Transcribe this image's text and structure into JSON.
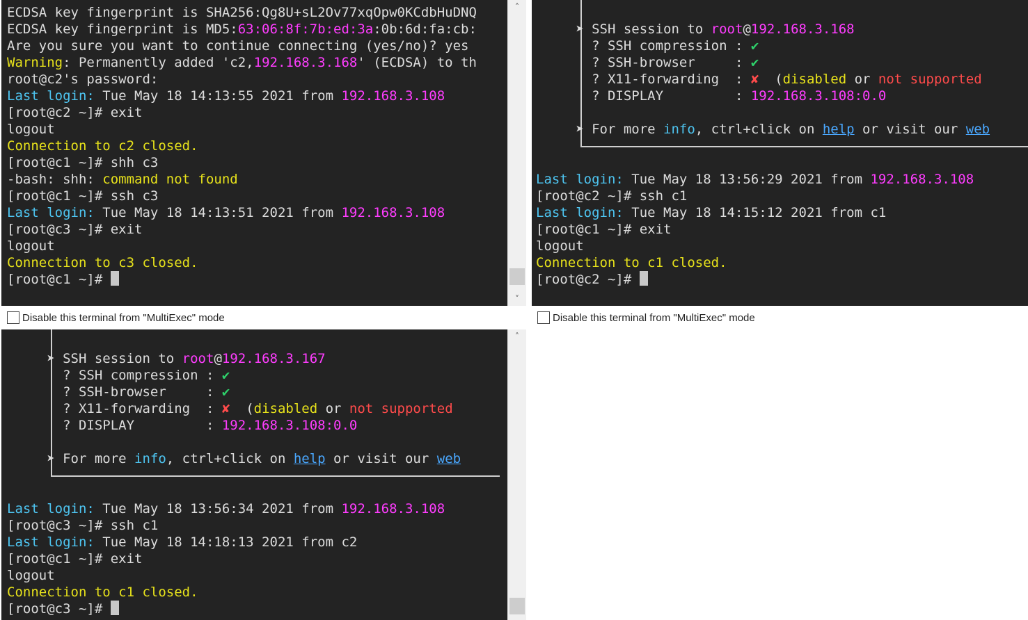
{
  "colors": {
    "background": "#232323",
    "text": "#dcdcdc",
    "cyan": "#4ec5f1",
    "magenta": "#ff3dff",
    "yellow": "#e7e21b",
    "red": "#ff4b4b",
    "green": "#2ed26b",
    "link": "#4aa8ff"
  },
  "panes": [
    {
      "id": "c1",
      "lines": [
        [
          {
            "t": "ECDSA key fingerprint is SHA256:Qg8U+sL2Ov77xqOpw0KCdbHuDNQ"
          }
        ],
        [
          {
            "t": "ECDSA key fingerprint is MD5:"
          },
          {
            "t": "63:06:8f:7b:ed:3a",
            "c": "magenta"
          },
          {
            "t": ":0b:6d:fa:cb:"
          }
        ],
        [
          {
            "t": "Are you sure you want to continue connecting (yes/no)? yes"
          }
        ],
        [
          {
            "t": "Warning",
            "c": "yellow"
          },
          {
            "t": ": Permanently added 'c2,"
          },
          {
            "t": "192.168.3.168",
            "c": "magenta"
          },
          {
            "t": "' (ECDSA) to th"
          }
        ],
        [
          {
            "t": "root@c2's password:"
          }
        ],
        [
          {
            "t": "Last login:",
            "c": "cyan"
          },
          {
            "t": " Tue May 18 14:13:55 2021 from "
          },
          {
            "t": "192.168.3.108",
            "c": "magenta"
          }
        ],
        [
          {
            "t": "[root@c2 ~]# exit"
          }
        ],
        [
          {
            "t": "logout"
          }
        ],
        [
          {
            "t": "Connection to c2 closed.",
            "c": "yellow"
          }
        ],
        [
          {
            "t": "[root@c1 ~]# shh c3"
          }
        ],
        [
          {
            "t": "-bash: shh: "
          },
          {
            "t": "command not found",
            "c": "yellow"
          }
        ],
        [
          {
            "t": "[root@c1 ~]# ssh c3"
          }
        ],
        [
          {
            "t": "Last login:",
            "c": "cyan"
          },
          {
            "t": " Tue May 18 14:13:51 2021 from "
          },
          {
            "t": "192.168.3.108",
            "c": "magenta"
          }
        ],
        [
          {
            "t": "[root@c3 ~]# exit"
          }
        ],
        [
          {
            "t": "logout"
          }
        ],
        [
          {
            "t": "Connection to c3 closed.",
            "c": "yellow"
          }
        ],
        [
          {
            "t": "[root@c1 ~]# "
          },
          {
            "cursor": true
          }
        ]
      ],
      "checkbox_label": "Disable this terminal from \"MultiExec\" mode"
    },
    {
      "id": "c2",
      "lines": [
        [
          {
            "t": ""
          }
        ],
        [
          {
            "t": "     ➤ SSH session to "
          },
          {
            "t": "root",
            "c": "magenta"
          },
          {
            "t": "@"
          },
          {
            "t": "192.168.3.168",
            "c": "magenta"
          }
        ],
        [
          {
            "t": "       ? SSH compression : "
          },
          {
            "t": "✔",
            "c": "green"
          }
        ],
        [
          {
            "t": "       ? SSH-browser     : "
          },
          {
            "t": "✔",
            "c": "green"
          }
        ],
        [
          {
            "t": "       ? X11-forwarding  : "
          },
          {
            "t": "✘",
            "c": "red"
          },
          {
            "t": "  ("
          },
          {
            "t": "disabled",
            "c": "yellow"
          },
          {
            "t": " or "
          },
          {
            "t": "not supported",
            "c": "red"
          }
        ],
        [
          {
            "t": "       ? DISPLAY         : "
          },
          {
            "t": "192.168.3.108:0.0",
            "c": "magenta"
          }
        ],
        [
          {
            "t": ""
          }
        ],
        [
          {
            "t": "     ➤ For more "
          },
          {
            "t": "info",
            "c": "cyan"
          },
          {
            "t": ", ctrl+click on "
          },
          {
            "t": "help",
            "c": "link",
            "u": true
          },
          {
            "t": " or visit our "
          },
          {
            "t": "web",
            "c": "link",
            "u": true
          }
        ],
        [
          {
            "t": ""
          }
        ],
        [
          {
            "t": ""
          }
        ],
        [
          {
            "t": "Last login:",
            "c": "cyan"
          },
          {
            "t": " Tue May 18 13:56:29 2021 from "
          },
          {
            "t": "192.168.3.108",
            "c": "magenta"
          }
        ],
        [
          {
            "t": "[root@c2 ~]# ssh c1"
          }
        ],
        [
          {
            "t": "Last login:",
            "c": "cyan"
          },
          {
            "t": " Tue May 18 14:15:12 2021 from c1"
          }
        ],
        [
          {
            "t": "[root@c1 ~]# exit"
          }
        ],
        [
          {
            "t": "logout"
          }
        ],
        [
          {
            "t": "Connection to c1 closed.",
            "c": "yellow"
          }
        ],
        [
          {
            "t": "[root@c2 ~]# "
          },
          {
            "cursor": true
          }
        ]
      ],
      "checkbox_label": "Disable this terminal from \"MultiExec\" mode"
    },
    {
      "id": "c3",
      "lines": [
        [
          {
            "t": ""
          }
        ],
        [
          {
            "t": "     ➤ SSH session to "
          },
          {
            "t": "root",
            "c": "magenta"
          },
          {
            "t": "@"
          },
          {
            "t": "192.168.3.167",
            "c": "magenta"
          }
        ],
        [
          {
            "t": "       ? SSH compression : "
          },
          {
            "t": "✔",
            "c": "green"
          }
        ],
        [
          {
            "t": "       ? SSH-browser     : "
          },
          {
            "t": "✔",
            "c": "green"
          }
        ],
        [
          {
            "t": "       ? X11-forwarding  : "
          },
          {
            "t": "✘",
            "c": "red"
          },
          {
            "t": "  ("
          },
          {
            "t": "disabled",
            "c": "yellow"
          },
          {
            "t": " or "
          },
          {
            "t": "not supported",
            "c": "red"
          }
        ],
        [
          {
            "t": "       ? DISPLAY         : "
          },
          {
            "t": "192.168.3.108:0.0",
            "c": "magenta"
          }
        ],
        [
          {
            "t": ""
          }
        ],
        [
          {
            "t": "     ➤ For more "
          },
          {
            "t": "info",
            "c": "cyan"
          },
          {
            "t": ", ctrl+click on "
          },
          {
            "t": "help",
            "c": "link",
            "u": true
          },
          {
            "t": " or visit our "
          },
          {
            "t": "web",
            "c": "link",
            "u": true
          }
        ],
        [
          {
            "t": ""
          }
        ],
        [
          {
            "t": ""
          }
        ],
        [
          {
            "t": "Last login:",
            "c": "cyan"
          },
          {
            "t": " Tue May 18 13:56:34 2021 from "
          },
          {
            "t": "192.168.3.108",
            "c": "magenta"
          }
        ],
        [
          {
            "t": "[root@c3 ~]# ssh c1"
          }
        ],
        [
          {
            "t": "Last login:",
            "c": "cyan"
          },
          {
            "t": " Tue May 18 14:18:13 2021 from c2"
          }
        ],
        [
          {
            "t": "[root@c1 ~]# exit"
          }
        ],
        [
          {
            "t": "logout"
          }
        ],
        [
          {
            "t": "Connection to c1 closed.",
            "c": "yellow"
          }
        ],
        [
          {
            "t": "[root@c3 ~]# "
          },
          {
            "cursor": true
          }
        ]
      ]
    }
  ]
}
